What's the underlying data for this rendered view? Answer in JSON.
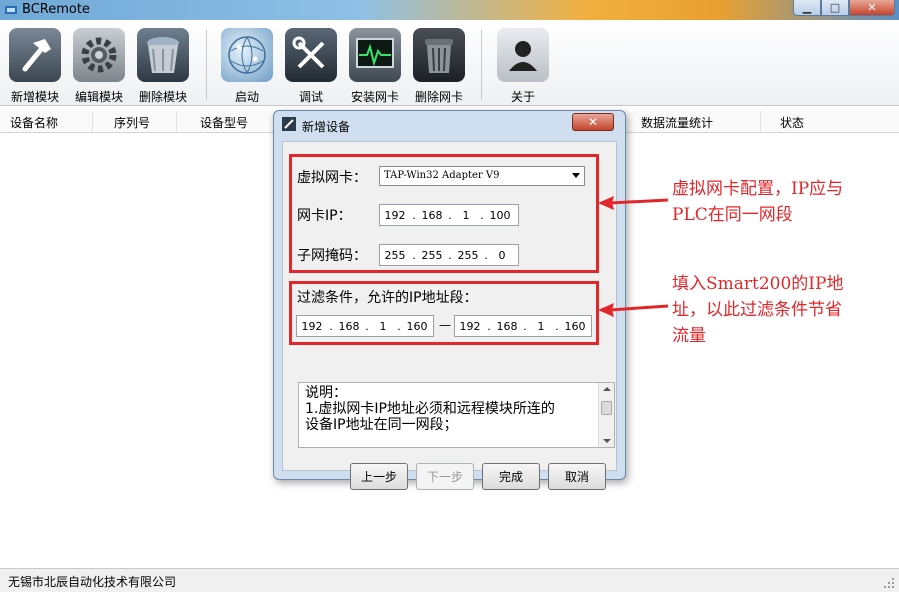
{
  "window": {
    "title": "BCRemote",
    "min_glyph": "▁",
    "max_glyph": "□",
    "close_glyph": "✕"
  },
  "toolbar": {
    "items": [
      {
        "label": "新增模块",
        "icon": "hammer-icon"
      },
      {
        "label": "编辑模块",
        "icon": "gear-icon"
      },
      {
        "label": "删除模块",
        "icon": "trash-icon"
      },
      {
        "label": "启动",
        "icon": "network-globe-icon"
      },
      {
        "label": "调试",
        "icon": "tools-icon"
      },
      {
        "label": "安装网卡",
        "icon": "monitor-pulse-icon"
      },
      {
        "label": "删除网卡",
        "icon": "trash-can-icon"
      },
      {
        "label": "关于",
        "icon": "user-icon"
      }
    ]
  },
  "table": {
    "columns": [
      "设备名称",
      "序列号",
      "设备型号",
      "数据流量统计",
      "状态"
    ]
  },
  "status": {
    "company": "无锡市北辰自动化技术有限公司"
  },
  "dialog": {
    "title": "新增设备",
    "close_glyph": "✕",
    "nic_label": "虚拟网卡：",
    "nic_value": "TAP-Win32 Adapter V9",
    "ip_label": "网卡IP：",
    "ip": [
      "192",
      "168",
      "1",
      "100"
    ],
    "mask_label": "子网掩码：",
    "mask": [
      "255",
      "255",
      "255",
      "0"
    ],
    "filter_label": "过滤条件，允许的IP地址段：",
    "range_from": [
      "192",
      "168",
      "1",
      "160"
    ],
    "range_sep": "—",
    "range_to": [
      "192",
      "168",
      "1",
      "160"
    ],
    "description": [
      "说明：",
      "1.虚拟网卡IP地址必须和远程模块所连的",
      "设备IP地址在同一网段；"
    ],
    "buttons": {
      "prev": "上一步",
      "next": "下一步",
      "finish": "完成",
      "cancel": "取消"
    }
  },
  "annotations": {
    "top": [
      "虚拟网卡配置，IP应与",
      "PLC在同一网段"
    ],
    "bottom": [
      "填入Smart200的IP地",
      "址，以此过滤条件节省",
      "流量"
    ],
    "color": "#e3262a"
  }
}
